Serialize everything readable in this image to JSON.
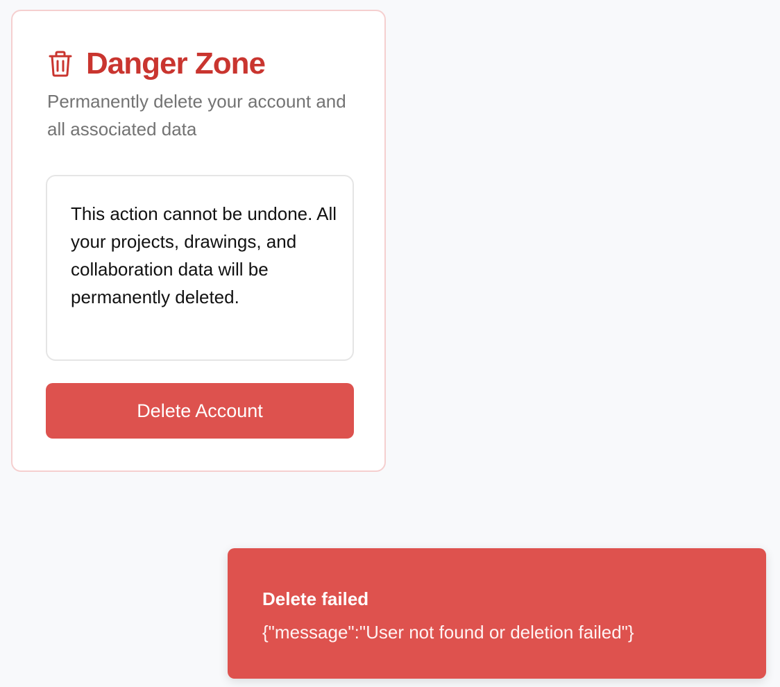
{
  "danger_zone": {
    "icon": "trash-icon",
    "title": "Danger Zone",
    "subtitle": "Permanently delete your account and all associated data",
    "warning": "This action cannot be undone. All your projects, drawings, and collaboration data will be permanently deleted.",
    "delete_button_label": "Delete Account"
  },
  "toast": {
    "title": "Delete failed",
    "message": "{\"message\":\"User not found or deletion failed\"}"
  },
  "colors": {
    "danger": "#c9352f",
    "button": "#dd524e",
    "card_border": "#f5cfcf",
    "background": "#f8f9fb"
  }
}
